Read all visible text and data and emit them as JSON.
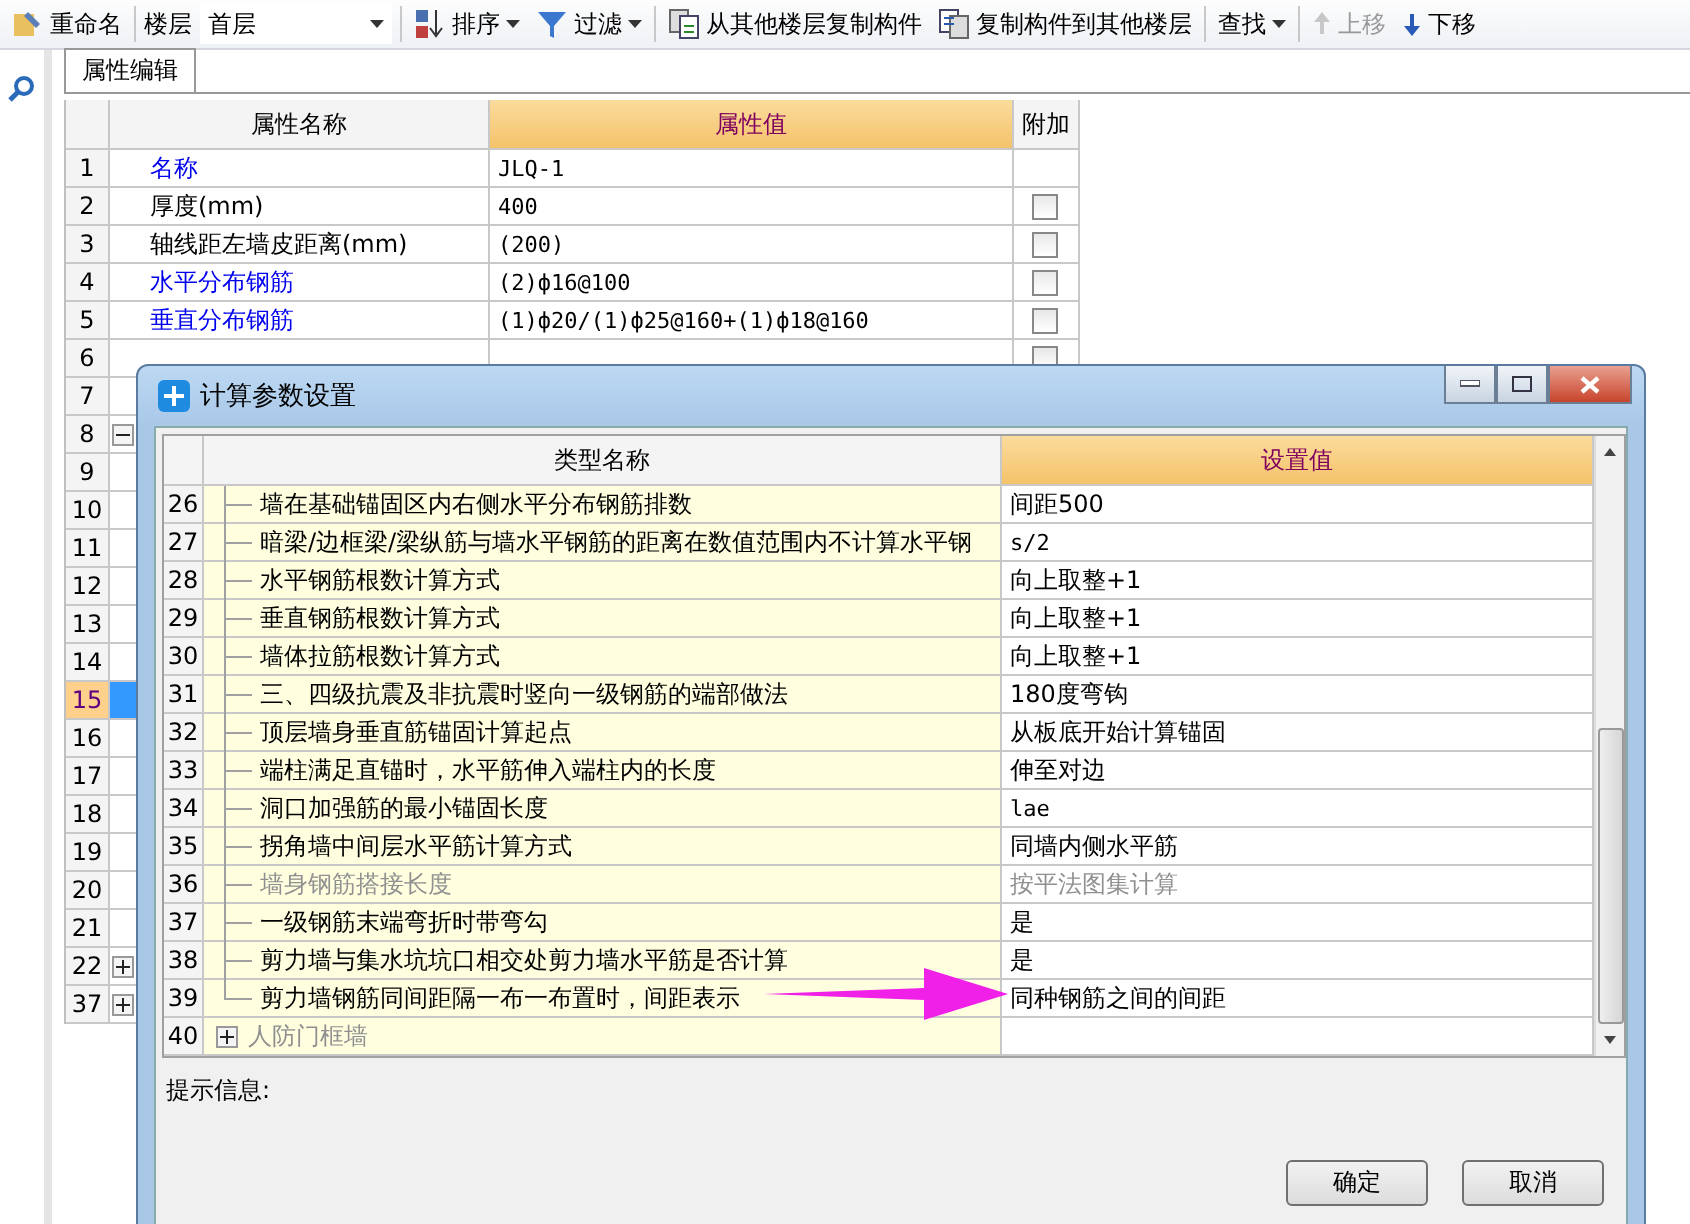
{
  "toolbar": {
    "rename": "重命名",
    "floor_label": "楼层",
    "floor_value": "首层",
    "sort": "排序",
    "filter": "过滤",
    "copy_from": "从其他楼层复制构件",
    "copy_to": "复制构件到其他楼层",
    "find": "查找",
    "move_up": {
      "label": "上移",
      "disabled": true
    },
    "move_down": {
      "label": "下移",
      "disabled": false
    }
  },
  "tabs": [
    {
      "label": "属性编辑",
      "selected": true
    }
  ],
  "property_grid": {
    "columns": [
      "属性名称",
      "属性值",
      "附加"
    ],
    "rows": [
      {
        "num": "1",
        "name": "名称",
        "value": "JLQ-1",
        "linked": true,
        "selected": false
      },
      {
        "num": "2",
        "name": "厚度(mm)",
        "value": "400",
        "linked": false,
        "checked": false,
        "selected": false
      },
      {
        "num": "3",
        "name": "轴线距左墙皮距离(mm)",
        "value": "(200)",
        "linked": false,
        "checked": false,
        "selected": false
      },
      {
        "num": "4",
        "name": "水平分布钢筋",
        "value": "(2)ф16@100",
        "linked": true,
        "checked": false,
        "selected": false
      },
      {
        "num": "5",
        "name": "垂直分布钢筋",
        "value": "(1)ф20/(1)ф25@160+(1)ф18@160",
        "linked": true,
        "checked": false,
        "selected": false
      },
      {
        "num": "6",
        "checked": false,
        "selected": false
      },
      {
        "num": "7",
        "selected": false
      },
      {
        "num": "8",
        "kind": "group",
        "expanded": true,
        "selected": false
      },
      {
        "num": "9",
        "selected": false
      },
      {
        "num": "10",
        "selected": false
      },
      {
        "num": "11",
        "selected": false
      },
      {
        "num": "12",
        "selected": false
      },
      {
        "num": "13",
        "selected": false
      },
      {
        "num": "14",
        "selected": false
      },
      {
        "num": "15",
        "selected": true
      },
      {
        "num": "16",
        "selected": false
      },
      {
        "num": "17",
        "selected": false
      },
      {
        "num": "18",
        "selected": false
      },
      {
        "num": "19",
        "selected": false
      },
      {
        "num": "20",
        "selected": false
      },
      {
        "num": "21",
        "selected": false
      },
      {
        "num": "22",
        "kind": "group",
        "expanded": false,
        "selected": false
      },
      {
        "num": "37",
        "kind": "group",
        "expanded": false,
        "selected": false
      }
    ]
  },
  "dialog": {
    "title": "计算参数设置",
    "columns": [
      "类型名称",
      "设置值"
    ],
    "rows": [
      {
        "num": "26",
        "kind": "child",
        "name": "墙在基础锚固区内右侧水平分布钢筋排数",
        "value": "间距500",
        "disabled": false
      },
      {
        "num": "27",
        "kind": "child",
        "name": "暗梁/边框梁/梁纵筋与墙水平钢筋的距离在数值范围内不计算水平钢",
        "value": "s/2",
        "disabled": false
      },
      {
        "num": "28",
        "kind": "child",
        "name": "水平钢筋根数计算方式",
        "value": "向上取整+1",
        "disabled": false
      },
      {
        "num": "29",
        "kind": "child",
        "name": "垂直钢筋根数计算方式",
        "value": "向上取整+1",
        "disabled": false
      },
      {
        "num": "30",
        "kind": "child",
        "name": "墙体拉筋根数计算方式",
        "value": "向上取整+1",
        "disabled": false
      },
      {
        "num": "31",
        "kind": "child",
        "name": "三、四级抗震及非抗震时竖向一级钢筋的端部做法",
        "value": "180度弯钩",
        "disabled": false
      },
      {
        "num": "32",
        "kind": "child",
        "name": "顶层墙身垂直筋锚固计算起点",
        "value": "从板底开始计算锚固",
        "disabled": false
      },
      {
        "num": "33",
        "kind": "child",
        "name": "端柱满足直锚时，水平筋伸入端柱内的长度",
        "value": "伸至对边",
        "disabled": false
      },
      {
        "num": "34",
        "kind": "child",
        "name": "洞口加强筋的最小锚固长度",
        "value": "lae",
        "disabled": false
      },
      {
        "num": "35",
        "kind": "child",
        "name": "拐角墙中间层水平筋计算方式",
        "value": "同墙内侧水平筋",
        "disabled": false
      },
      {
        "num": "36",
        "kind": "child",
        "name": "墙身钢筋搭接长度",
        "value": "按平法图集计算",
        "disabled": true
      },
      {
        "num": "37",
        "kind": "child",
        "name": "一级钢筋末端弯折时带弯勾",
        "value": "是",
        "disabled": false
      },
      {
        "num": "38",
        "kind": "child",
        "name": "剪力墙与集水坑坑口相交处剪力墙水平筋是否计算",
        "value": "是",
        "disabled": false
      },
      {
        "num": "39",
        "kind": "last_child",
        "name": "剪力墙钢筋同间距隔一布一布置时，间距表示",
        "value": "同种钢筋之间的间距",
        "disabled": false
      },
      {
        "num": "40",
        "kind": "group",
        "name": "人防门框墙",
        "expanded": false,
        "disabled": true
      }
    ],
    "hint_label": "提示信息:",
    "buttons": [
      "确定",
      "取消"
    ]
  }
}
